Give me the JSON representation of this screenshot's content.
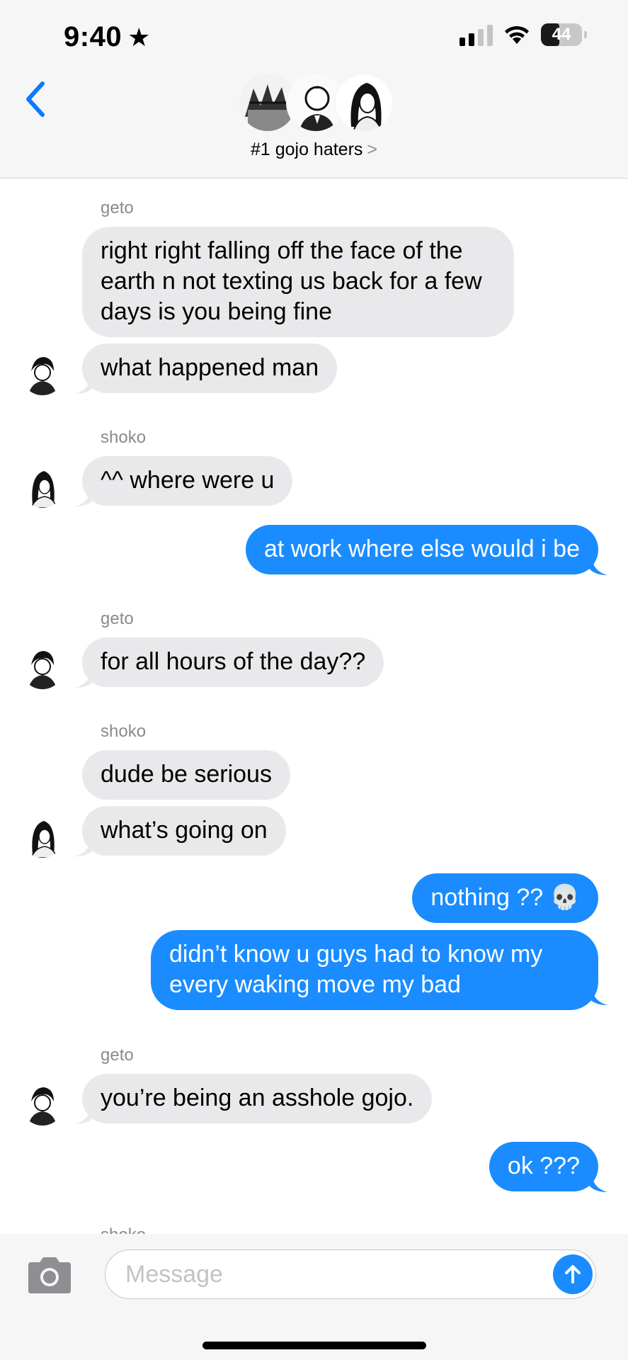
{
  "status_bar": {
    "time": "9:40",
    "battery": "44",
    "battery_level": 0.44
  },
  "header": {
    "group_name": "#1 gojo haters",
    "back_icon": "chevron-left-icon"
  },
  "thread": {
    "messages": [
      {
        "sender": "geto"
      },
      {
        "text": "right right falling off the face of the earth n not texting us back for a few days is you being fine"
      },
      {
        "text": "what happened man"
      },
      {
        "sender": "shoko"
      },
      {
        "text": "^^ where were u"
      },
      {
        "text": "at work where else would i be"
      },
      {
        "sender": "geto"
      },
      {
        "text": "for all hours of the day??"
      },
      {
        "sender": "shoko"
      },
      {
        "text": "dude be serious"
      },
      {
        "text": "what’s going on"
      },
      {
        "text": "nothing ?? 💀"
      },
      {
        "text": "didn’t know u guys had to know my every waking move my bad"
      },
      {
        "sender": "geto"
      },
      {
        "text": "you’re being an asshole gojo."
      },
      {
        "text": "ok ???"
      },
      {
        "sender": "shoko"
      }
    ]
  },
  "composer": {
    "placeholder": "Message"
  },
  "colors": {
    "incoming_bubble": "#e9e9eb",
    "outgoing_bubble": "#1a8cff",
    "accent": "#0a7aff"
  },
  "icons": [
    "star-icon",
    "signal-icon",
    "wifi-icon",
    "battery-icon",
    "chevron-left-icon",
    "camera-icon",
    "send-arrow-icon"
  ]
}
